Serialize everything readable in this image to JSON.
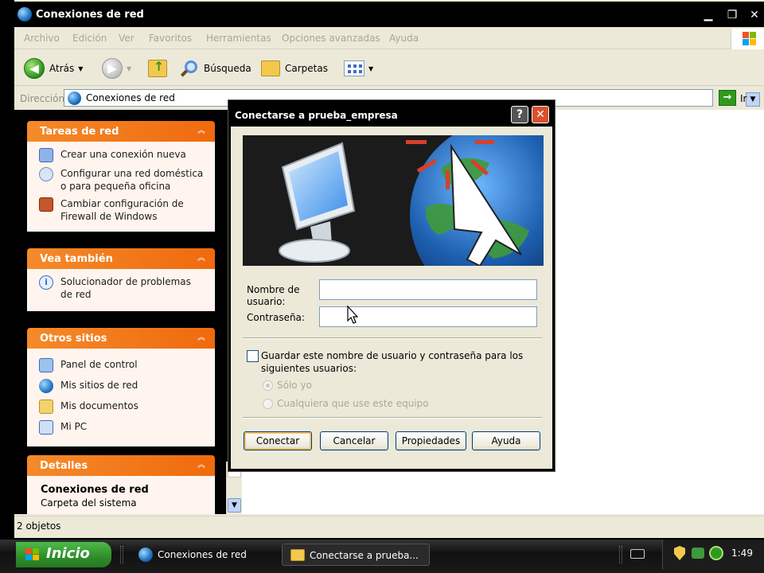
{
  "window": {
    "title": "Conexiones de red"
  },
  "menu": [
    "Archivo",
    "Edición",
    "Ver",
    "Favoritos",
    "Herramientas",
    "Opciones avanzadas",
    "Ayuda"
  ],
  "toolbar": {
    "back_label": "Atrás",
    "search_label": "Búsqueda",
    "folders_label": "Carpetas"
  },
  "address": {
    "label": "Dirección",
    "value": "Conexiones de red",
    "go_label": "Ir"
  },
  "panels": {
    "network_tasks": {
      "title": "Tareas de red",
      "items": [
        {
          "label": "Crear una conexión nueva",
          "icon": "new-connection-icon"
        },
        {
          "label": "Configurar una red doméstica o para pequeña oficina",
          "icon": "home-network-icon"
        },
        {
          "label": "Cambiar configuración de Firewall de Windows",
          "icon": "firewall-icon"
        }
      ]
    },
    "see_also": {
      "title": "Vea también",
      "items": [
        {
          "label": "Solucionador de problemas de red",
          "icon": "info-icon"
        }
      ]
    },
    "other_places": {
      "title": "Otros sitios",
      "items": [
        {
          "label": "Panel de control",
          "icon": "control-panel-icon"
        },
        {
          "label": "Mis sitios de red",
          "icon": "network-places-icon"
        },
        {
          "label": "Mis documentos",
          "icon": "documents-icon"
        },
        {
          "label": "Mi PC",
          "icon": "computer-icon"
        }
      ]
    },
    "details": {
      "title": "Detalles",
      "name": "Conexiones de red",
      "subtitle": "Carpeta del sistema"
    }
  },
  "statusbar": {
    "text": "2 objetos"
  },
  "dialog": {
    "title": "Conectarse a prueba_empresa",
    "username_label": "Nombre de usuario:",
    "username_value": "",
    "password_label": "Contraseña:",
    "password_value": "",
    "save_checkbox_label": "Guardar este nombre de usuario y contraseña para los siguientes usuarios:",
    "save_checked": false,
    "radio_only_me": "Sólo yo",
    "radio_anyone": "Cualquiera que use este equipo",
    "buttons": {
      "connect": "Conectar",
      "cancel": "Cancelar",
      "properties": "Propiedades",
      "help": "Ayuda"
    }
  },
  "taskbar": {
    "start_label": "Inicio",
    "tasks": [
      {
        "label": "Conexiones de red",
        "icon": "network-connections-icon"
      },
      {
        "label": "Conectarse a prueba...",
        "icon": "folder-icon"
      }
    ],
    "clock": "1:49"
  },
  "colors": {
    "panel_header": "#ef6a0d",
    "panel_body": "#fff5ee",
    "start_button": "#2f8c2a",
    "dialog_bg": "#ece9d8"
  }
}
